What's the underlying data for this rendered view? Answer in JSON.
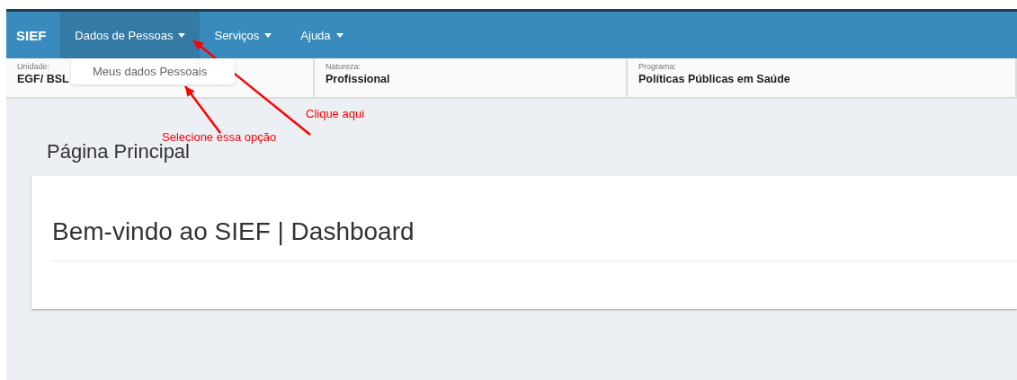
{
  "navbar": {
    "brand": "SIEF",
    "menus": [
      {
        "label": "Dados de Pessoas",
        "selected": true,
        "items": [
          "Meus dados Pessoais"
        ]
      },
      {
        "label": "Serviços",
        "selected": false
      },
      {
        "label": "Ajuda",
        "selected": false
      }
    ]
  },
  "context_bar": [
    {
      "label": "Unidade:",
      "value": "EGF/ BSL"
    },
    {
      "label": "Natureza:",
      "value": "Profissional"
    },
    {
      "label": "Programa:",
      "value": "Políticas Públicas em Saúde"
    }
  ],
  "page_title": "Página Principal",
  "card": {
    "title": "Bem-vindo ao SIEF | Dashboard"
  },
  "annotations": [
    {
      "text": "Clique aqui",
      "color": "#ff0000"
    },
    {
      "text": "Selecione essa opção",
      "color": "#ff0000"
    }
  ]
}
